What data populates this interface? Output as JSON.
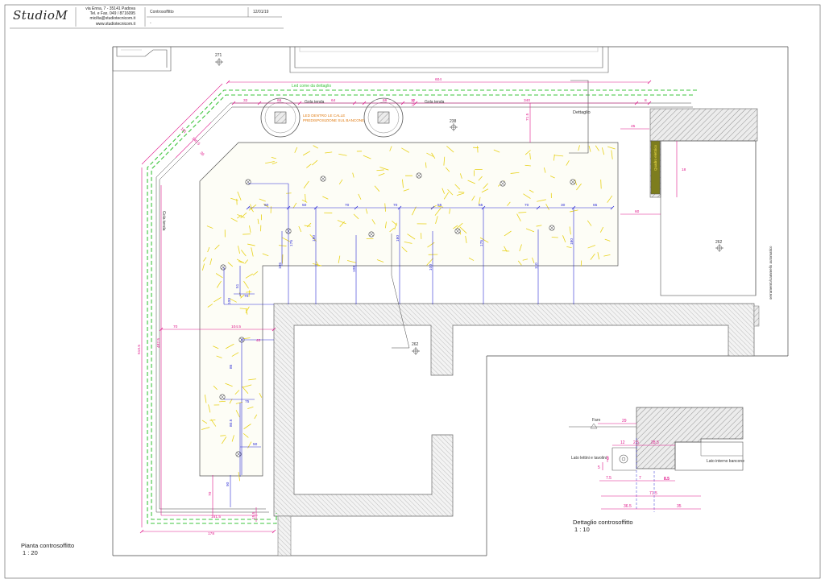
{
  "title_block": {
    "logo": "StudioM",
    "address_lines": [
      "via Enna, 7 - 35141 Padova",
      "Tel. e Fax. 049 / 8716095",
      "micilta@studiotecnicom.it",
      "www.studiotecnicom.it"
    ],
    "subject": "Controsoffitto",
    "date": "12/01/19",
    "note": "-"
  },
  "plan": {
    "caption": "Pianta controsoffitto",
    "scale": "1 : 20",
    "labels": {
      "led_note": "Led come da dettaglio",
      "gola_tenda_1": "Gola tenda",
      "gola_tenda_2": "Gola tenda",
      "gola_tenda_vertical": "Gola tenda",
      "led_inside": "LED DENTRO LE CALLE",
      "predisposizione": "PREDISPOSIZIONE SUL BANCONE",
      "dettaglio": "Dettaglio",
      "quadro": "Quadro elettrico",
      "serramento": "serramento/cammello automatico"
    },
    "heights": [
      "271",
      "238",
      "262",
      "262",
      "262"
    ],
    "dims_magenta": [
      "604",
      "32",
      "66",
      "64",
      "66",
      "12",
      "340",
      "8",
      "161",
      "140.5",
      "36",
      "45",
      "18",
      "60",
      "70",
      "104.5",
      "40",
      "510.5",
      "482.5",
      "70",
      "161.5",
      "178",
      "15.5",
      "11.5",
      "71.5"
    ],
    "dims_blue": [
      "60",
      "50",
      "70",
      "70",
      "55",
      "65",
      "70",
      "30",
      "65",
      "175",
      "180",
      "106",
      "108",
      "180",
      "100",
      "175",
      "110",
      "180",
      "51",
      "100",
      "70",
      "85",
      "75",
      "80.5",
      "50",
      "90"
    ]
  },
  "detail": {
    "caption": "Dettaglio controsoffitto",
    "scale": "1 : 10",
    "labels": {
      "faro": "Faro",
      "lato_lettini": "Lato lettini e tavolini",
      "lato_interno": "Lato interno bancone"
    },
    "dims": [
      "29",
      "12",
      "2.5",
      "28.5",
      "7.5",
      "7",
      "8.5",
      "71.5",
      "36.5",
      "35",
      "3",
      "5"
    ]
  },
  "colors": {
    "dim_magenta": "#e0188c",
    "dim_blue": "#2d2dd6",
    "led_green": "#3ec43e",
    "texture_yellow": "#e8d21a",
    "hatch": "#777777"
  }
}
